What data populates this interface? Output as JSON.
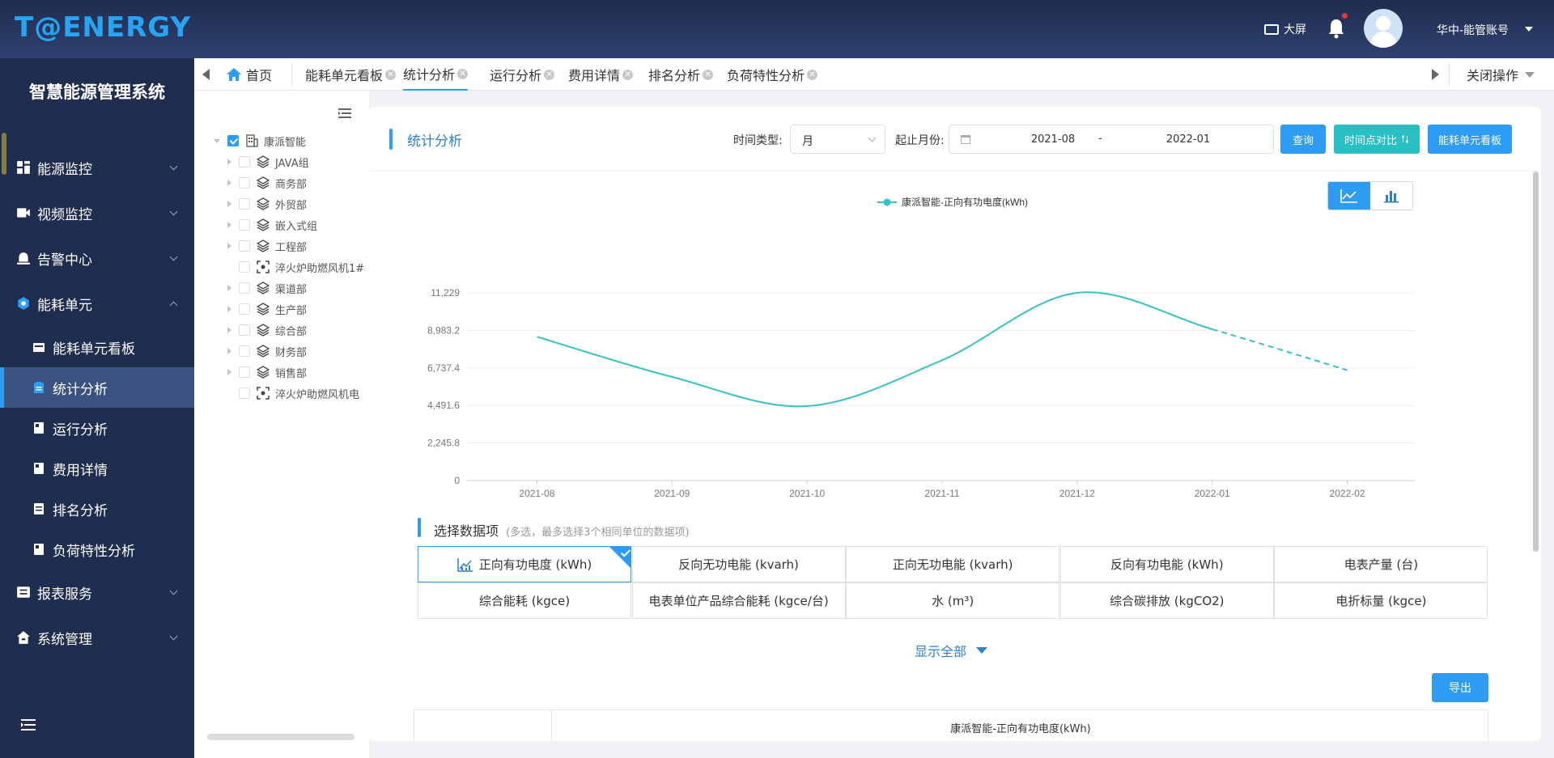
{
  "header": {
    "logo": "T@ENERGY",
    "big_screen": "大屏",
    "account": "华中-能管账号"
  },
  "sidebar": {
    "title": "智慧能源管理系统",
    "menus": [
      {
        "label": "能源监控",
        "icon": "dashboard-icon",
        "expanded": false
      },
      {
        "label": "视频监控",
        "icon": "video-icon",
        "expanded": false
      },
      {
        "label": "告警中心",
        "icon": "alarm-icon",
        "expanded": false
      },
      {
        "label": "能耗单元",
        "icon": "energy-unit-icon",
        "expanded": true
      },
      {
        "label": "报表服务",
        "icon": "report-icon",
        "expanded": false
      },
      {
        "label": "系统管理",
        "icon": "home-settings-icon",
        "expanded": false
      }
    ],
    "sub_items": [
      {
        "label": "能耗单元看板",
        "active": false
      },
      {
        "label": "统计分析",
        "active": true
      },
      {
        "label": "运行分析",
        "active": false
      },
      {
        "label": "费用详情",
        "active": false
      },
      {
        "label": "排名分析",
        "active": false
      },
      {
        "label": "负荷特性分析",
        "active": false
      }
    ]
  },
  "tabs": {
    "home": "首页",
    "items": [
      {
        "label": "能耗单元看板",
        "active": false
      },
      {
        "label": "统计分析",
        "active": true
      },
      {
        "label": "运行分析",
        "active": false
      },
      {
        "label": "费用详情",
        "active": false
      },
      {
        "label": "排名分析",
        "active": false
      },
      {
        "label": "负荷特性分析",
        "active": false
      }
    ],
    "close_ops": "关闭操作"
  },
  "tree": {
    "root": "康派智能",
    "children": [
      {
        "label": "JAVA组",
        "type": "group"
      },
      {
        "label": "商务部",
        "type": "group"
      },
      {
        "label": "外贸部",
        "type": "group"
      },
      {
        "label": "嵌入式组",
        "type": "group"
      },
      {
        "label": "工程部",
        "type": "group"
      },
      {
        "label": "淬火炉助燃风机1#",
        "type": "device"
      },
      {
        "label": "渠道部",
        "type": "group"
      },
      {
        "label": "生产部",
        "type": "group"
      },
      {
        "label": "综合部",
        "type": "group"
      },
      {
        "label": "财务部",
        "type": "group"
      },
      {
        "label": "销售部",
        "type": "group"
      },
      {
        "label": "淬火炉助燃风机电",
        "type": "device"
      }
    ]
  },
  "main": {
    "title": "统计分析",
    "time_type_label": "时间类型:",
    "time_type_value": "月",
    "range_label": "起止月份:",
    "range_start": "2021-08",
    "range_sep": "-",
    "range_end": "2022-01",
    "btn_query": "查询",
    "btn_compare": "时间点对比",
    "btn_board": "能耗单元看板",
    "section_title": "选择数据项",
    "section_hint": "(多选，最多选择3个相同单位的数据项)",
    "data_items": [
      {
        "label": "正向有功电度 (kWh)",
        "selected": true
      },
      {
        "label": "反向无功电能 (kvarh)",
        "selected": false
      },
      {
        "label": "正向无功电能 (kvarh)",
        "selected": false
      },
      {
        "label": "反向有功电能 (kWh)",
        "selected": false
      },
      {
        "label": "电表产量 (台)",
        "selected": false
      },
      {
        "label": "综合能耗 (kgce)",
        "selected": false
      },
      {
        "label": "电表单位产品综合能耗 (kgce/台)",
        "selected": false
      },
      {
        "label": "水 (m³)",
        "selected": false
      },
      {
        "label": "综合碳排放 (kgCO2)",
        "selected": false
      },
      {
        "label": "电折标量 (kgce)",
        "selected": false
      }
    ],
    "show_all": "显示全部",
    "export": "导出",
    "table_header": "康派智能-正向有功电度(kWh)"
  },
  "chart_data": {
    "type": "line",
    "smooth": true,
    "legend_position": "top-center",
    "categories": [
      "2021-08",
      "2021-09",
      "2021-10",
      "2021-11",
      "2021-12",
      "2022-01",
      "2022-02"
    ],
    "y_ticks": [
      "0",
      "2,245.8",
      "4,491.6",
      "6,737.4",
      "8,983.2",
      "11,229"
    ],
    "ylim": [
      0,
      11229
    ],
    "grid": true,
    "series": [
      {
        "name": "康派智能-正向有功电度(kWh)",
        "color": "#36c2c4",
        "values": [
          8600,
          6200,
          4450,
          7200,
          11229,
          9050,
          6600
        ],
        "forecast_from_index": 5
      }
    ]
  }
}
